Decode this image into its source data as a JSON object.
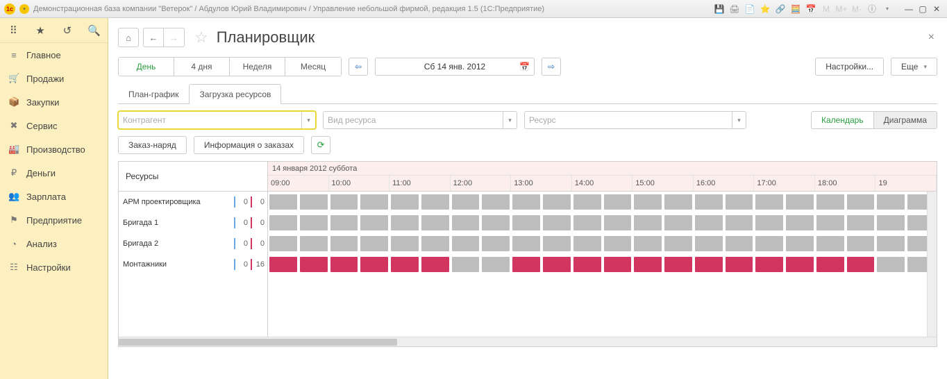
{
  "window": {
    "title": "Демонстрационная база компании \"Ветерок\" / Абдулов Юрий Владимирович / Управление небольшой фирмой, редакция 1.5  (1С:Предприятие)"
  },
  "sidebar": {
    "items": [
      {
        "icon": "≡",
        "label": "Главное"
      },
      {
        "icon": "🛒",
        "label": "Продажи"
      },
      {
        "icon": "📦",
        "label": "Закупки"
      },
      {
        "icon": "✖",
        "label": "Сервис"
      },
      {
        "icon": "🏭",
        "label": "Производство"
      },
      {
        "icon": "₽",
        "label": "Деньги"
      },
      {
        "icon": "👥",
        "label": "Зарплата"
      },
      {
        "icon": "⚑",
        "label": "Предприятие"
      },
      {
        "icon": "◔",
        "label": "Анализ"
      },
      {
        "icon": "☷",
        "label": "Настройки"
      }
    ]
  },
  "page": {
    "title": "Планировщик"
  },
  "periods": {
    "items": [
      "День",
      "4 дня",
      "Неделя",
      "Месяц"
    ],
    "active": 0
  },
  "date": {
    "text": "Сб 14 янв. 2012"
  },
  "buttons": {
    "settings": "Настройки...",
    "more": "Еще",
    "order": "Заказ-наряд",
    "orderinfo": "Информация о заказах"
  },
  "tabs": {
    "items": [
      "План-график",
      "Загрузка ресурсов"
    ],
    "active": 1
  },
  "filters": {
    "counterparty": "Контрагент",
    "restype": "Вид ресурса",
    "resource": "Ресурс"
  },
  "view": {
    "calendar": "Календарь",
    "diagram": "Диаграмма"
  },
  "grid": {
    "resources_header": "Ресурсы",
    "day_label": "14 января 2012 суббота",
    "hours": [
      "09:00",
      "10:00",
      "11:00",
      "12:00",
      "13:00",
      "14:00",
      "15:00",
      "16:00",
      "17:00",
      "18:00",
      "19"
    ],
    "rows": [
      {
        "name": "АРМ проектировщика",
        "v1": 0,
        "v2": 0,
        "pattern": "ggggggggggg"
      },
      {
        "name": "Бригада 1",
        "v1": 0,
        "v2": 0,
        "pattern": "ggggggggggg"
      },
      {
        "name": "Бригада 2",
        "v1": 0,
        "v2": 0,
        "pattern": "ggggggggggg"
      },
      {
        "name": "Монтажники",
        "v1": 0,
        "v2": 16,
        "pattern": "pppgppppppg"
      }
    ]
  }
}
